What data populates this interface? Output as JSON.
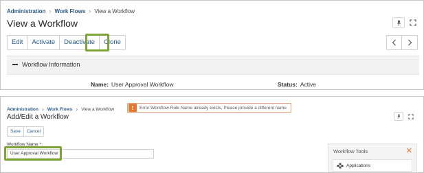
{
  "view": {
    "breadcrumb": [
      "Administration",
      "Work Flows",
      "View a Workflow"
    ],
    "title": "View a Workflow",
    "actions": [
      "Edit",
      "Activate",
      "Deactivate",
      "Clone"
    ],
    "section": {
      "title": "Workflow Information",
      "name_label": "Name:",
      "name_value": "User Approval Workflow",
      "status_label": "Status:",
      "status_value": "Active"
    }
  },
  "edit": {
    "breadcrumb": [
      "Administration",
      "Work Flows",
      "View a Workflow"
    ],
    "title": "Add/Edit a Workflow",
    "error_message": "Error:Workflow Rule Name already exists, Please provide a different name",
    "actions": [
      "Save",
      "Cancel"
    ],
    "name_label": "Workflow Name *:",
    "name_value": "User Approval Workflow",
    "tools": {
      "title": "Workflow Tools",
      "item": "Applications"
    }
  },
  "colors": {
    "link": "#2a5a8c",
    "highlight": "#7da534",
    "error_accent": "#e8772e"
  },
  "icons": [
    "pin-icon",
    "expand-icon",
    "chevron-left-icon",
    "chevron-right-icon",
    "collapse-icon",
    "error-icon",
    "close-icon",
    "applications-icon"
  ]
}
